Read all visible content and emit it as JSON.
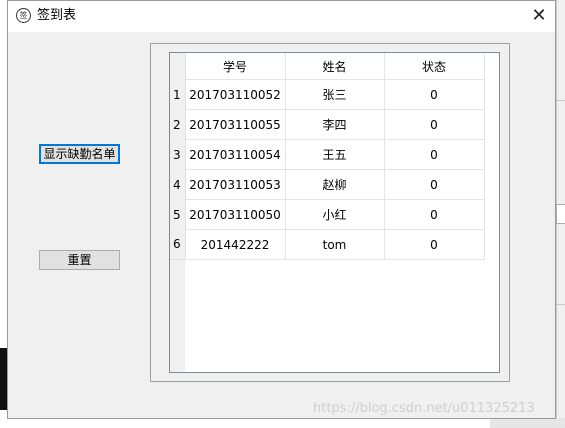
{
  "window": {
    "title": "签到表",
    "icon_glyph": "签",
    "close_glyph": "✕"
  },
  "buttons": {
    "show_absent": "显示缺勤名单",
    "reset": "重置"
  },
  "table": {
    "headers": [
      "学号",
      "姓名",
      "状态"
    ],
    "rows": [
      {
        "num": "1",
        "id": "201703110052",
        "name": "张三",
        "status": "0"
      },
      {
        "num": "2",
        "id": "201703110055",
        "name": "李四",
        "status": "0"
      },
      {
        "num": "3",
        "id": "201703110054",
        "name": "王五",
        "status": "0"
      },
      {
        "num": "4",
        "id": "201703110053",
        "name": "赵柳",
        "status": "0"
      },
      {
        "num": "5",
        "id": "201703110050",
        "name": "小红",
        "status": "0"
      },
      {
        "num": "6",
        "id": "201442222",
        "name": "tom",
        "status": "0"
      }
    ]
  },
  "watermark": "https://blog.csdn.net/u011325213"
}
